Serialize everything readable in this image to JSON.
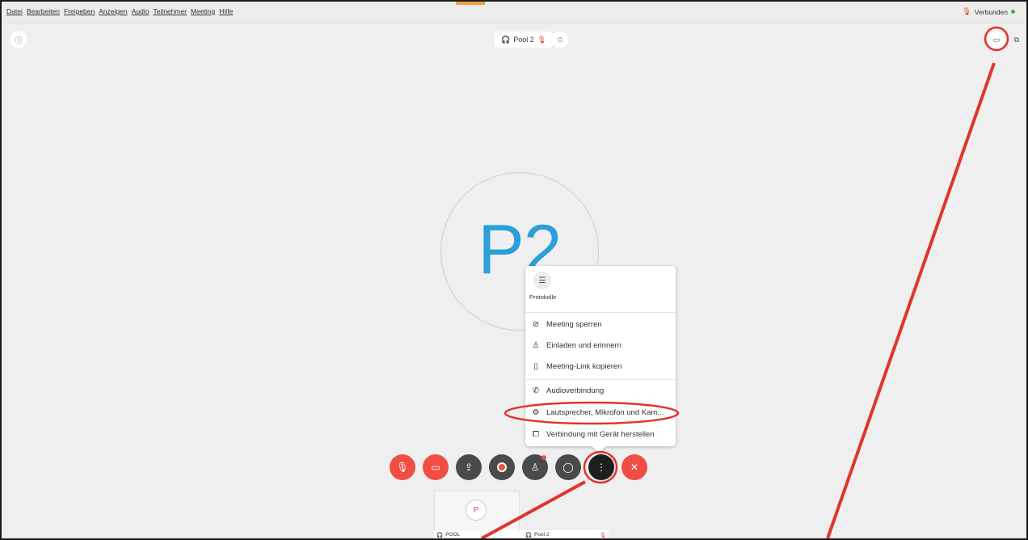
{
  "menubar": {
    "items": [
      "Datei",
      "Bearbeiten",
      "Freigeben",
      "Anzeigen",
      "Audio",
      "Teilnehmer",
      "Meeting",
      "Hilfe"
    ],
    "status": "Verbunden",
    "status_color": "#3bb54a"
  },
  "header": {
    "meeting_title": "Pool 2",
    "left_icon": "info-icon",
    "right_icons": [
      "layout-icon",
      "popout-icon"
    ]
  },
  "main": {
    "avatar_initials": "P2",
    "avatar_color": "#2a9fd8"
  },
  "more_menu": {
    "top_item_label": "Protokolle",
    "items": [
      {
        "label": "Meeting sperren",
        "icon": "lock-icon"
      },
      {
        "label": "Einladen und erinnern",
        "icon": "invite-icon"
      },
      {
        "label": "Meeting-Link kopieren",
        "icon": "copy-icon"
      },
      {
        "label": "Audioverbindung",
        "icon": "phone-icon"
      },
      {
        "label": "Lautsprecher, Mikrofon und Kam...",
        "icon": "gear-icon"
      },
      {
        "label": "Verbindung mit Gerät herstellen",
        "icon": "cast-icon"
      }
    ]
  },
  "toolbar": {
    "buttons": [
      "mute-button",
      "stop-video-button",
      "share-button",
      "record-button",
      "participants-button",
      "chat-button",
      "more-button",
      "leave-button"
    ],
    "accent": "#f04e44"
  },
  "self_view": {
    "avatar_initial": "P",
    "labels": [
      "POOL",
      "Pool 2"
    ]
  }
}
